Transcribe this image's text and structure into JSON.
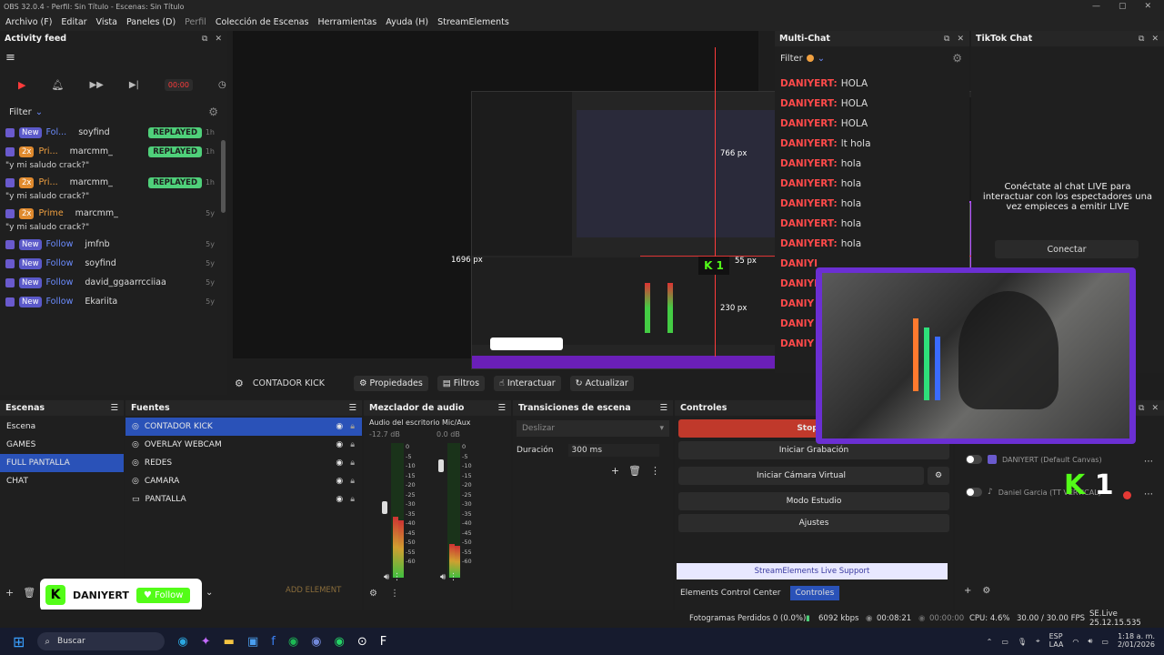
{
  "window": {
    "title": "OBS 32.0.4 - Perfil: Sin Título - Escenas: Sin Título"
  },
  "menu": [
    "Archivo (F)",
    "Editar",
    "Vista",
    "Paneles (D)",
    "Perfil",
    "Colección de Escenas",
    "Herramientas",
    "Ayuda (H)",
    "StreamElements"
  ],
  "activity_feed": {
    "title": "Activity feed",
    "filter": "Filter",
    "counter": "00:00",
    "items": [
      {
        "b1": "New",
        "b2": "Fol...",
        "user": "soyfind",
        "tag": "REPLAYED",
        "time": "1h",
        "msg": ""
      },
      {
        "b1": "2x",
        "b2": "Pri...",
        "user": "marcmm_",
        "tag": "REPLAYED",
        "time": "1h",
        "msg": "\"y mi saludo crack?\""
      },
      {
        "b1": "2x",
        "b2": "Pri...",
        "user": "marcmm_",
        "tag": "REPLAYED",
        "time": "1h",
        "msg": "\"y mi saludo crack?\""
      },
      {
        "b1": "2x",
        "b2": "Prime",
        "user": "marcmm_",
        "tag": "",
        "time": "5y",
        "msg": "\"y mi saludo crack?\""
      },
      {
        "b1": "New",
        "b2": "Follow",
        "user": "jmfnb",
        "tag": "",
        "time": "5y",
        "msg": ""
      },
      {
        "b1": "New",
        "b2": "Follow",
        "user": "soyfind",
        "tag": "",
        "time": "5y",
        "msg": ""
      },
      {
        "b1": "New",
        "b2": "Follow",
        "user": "david_ggaarrcciiaa",
        "tag": "",
        "time": "5y",
        "msg": ""
      },
      {
        "b1": "New",
        "b2": "Follow",
        "user": "Ekariita",
        "tag": "",
        "time": "5y",
        "msg": ""
      }
    ]
  },
  "preview": {
    "measure1": "1696 px",
    "measure2": "766 px",
    "measure3": "55 px",
    "measure4": "230 px"
  },
  "source_bar": {
    "source": "CONTADOR KICK",
    "properties": "Propiedades",
    "filters": "Filtros",
    "interact": "Interactuar",
    "refresh": "Actualizar"
  },
  "scenes": {
    "title": "Escenas",
    "items": [
      "Escena",
      "GAMES",
      "FULL PANTALLA",
      "CHAT"
    ],
    "selected": "FULL PANTALLA"
  },
  "sources": {
    "title": "Fuentes",
    "items": [
      "CONTADOR KICK",
      "OVERLAY WEBCAM",
      "REDES",
      "CAMARA",
      "PANTALLA"
    ]
  },
  "mixer": {
    "title": "Mezclador de audio",
    "ch1": "Audio del escritorio",
    "ch2": "Mic/Aux",
    "ch1_db": "-12.7 dB",
    "ch2_db": "0.0 dB",
    "ch1_level": 0.45,
    "ch2_level": 0.25,
    "scale": [
      "0",
      "-5",
      "-10",
      "-15",
      "-20",
      "-25",
      "-30",
      "-35",
      "-40",
      "-45",
      "-50",
      "-55",
      "-60"
    ]
  },
  "transitions": {
    "title": "Transiciones de escena",
    "selected": "Deslizar",
    "duration_label": "Duración",
    "duration_value": "300 ms"
  },
  "controls": {
    "title": "Controles",
    "buttons": [
      "Stop St",
      "Iniciar Grabación",
      "Iniciar Cámara Virtual",
      "Modo Estudio",
      "Ajustes"
    ],
    "support": "StreamElements Live Support",
    "tab1": "Elements Control Center",
    "tab2": "Controles"
  },
  "multichat": {
    "title": "Multi-Chat",
    "filter": "Filter",
    "messages": [
      {
        "user": "DANIYERT:",
        "text": "HOLA"
      },
      {
        "user": "DANIYERT:",
        "text": "HOLA"
      },
      {
        "user": "DANIYERT:",
        "text": "HOLA"
      },
      {
        "user": "DANIYERT:",
        "text": "lt hola"
      },
      {
        "user": "DANIYERT:",
        "text": "hola"
      },
      {
        "user": "DANIYERT:",
        "text": "hola"
      },
      {
        "user": "DANIYERT:",
        "text": "hola"
      },
      {
        "user": "DANIYERT:",
        "text": "hola"
      },
      {
        "user": "DANIYERT:",
        "text": "hola"
      },
      {
        "user": "DANIYI",
        "text": ""
      },
      {
        "user": "DANIYI",
        "text": ""
      },
      {
        "user": "DANIY",
        "text": ""
      },
      {
        "user": "DANIY",
        "text": ""
      },
      {
        "user": "DANIY",
        "text": ""
      }
    ]
  },
  "tiktok": {
    "title": "TikTok Chat",
    "message": "Conéctate al chat LIVE para interactuar con los espectadores una vez empieces a emitir LIVE",
    "connect": "Conectar"
  },
  "accounts": [
    {
      "name": "DANIYERT (Default Canvas)"
    },
    {
      "name": "Daniel Garcia (TT VERTICAL)"
    }
  ],
  "kick_widget": {
    "name": "DANIYERT",
    "follow": "Follow",
    "counter_label": "1"
  },
  "add_element": "ADD ELEMENT",
  "status": {
    "dropped": "Fotogramas Perdidos 0 (0.0%)",
    "kbps": "6092 kbps",
    "live_time": "00:08:21",
    "rec_time": "00:00:00",
    "cpu": "CPU: 4.6%",
    "fps": "30.00 / 30.00 FPS",
    "version": "SE.Live 25.12.15.535"
  },
  "taskbar": {
    "search": "Buscar",
    "lang1": "ESP",
    "lang2": "LAA",
    "time": "1:18 a. m.",
    "date": "2/01/2026"
  }
}
